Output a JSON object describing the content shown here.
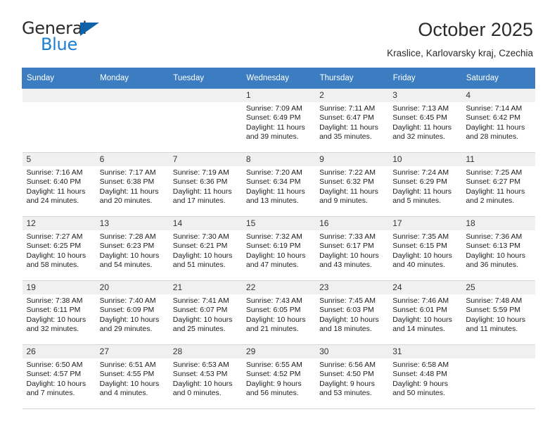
{
  "brand": {
    "name_primary": "General",
    "name_secondary": "Blue",
    "primary_color": "#2b2b2b",
    "secondary_color": "#1a7fd4",
    "triangle_color": "#0f62a8"
  },
  "header": {
    "month_title": "October 2025",
    "location": "Kraslice, Karlovarsky kraj, Czechia"
  },
  "calendar": {
    "header_bg": "#3b7dc0",
    "daynum_bg": "#f0f0f0",
    "weekday_headers": [
      "Sunday",
      "Monday",
      "Tuesday",
      "Wednesday",
      "Thursday",
      "Friday",
      "Saturday"
    ],
    "weeks": [
      [
        {
          "day": "",
          "sunrise": "",
          "sunset": "",
          "daylight": "",
          "daylight2": ""
        },
        {
          "day": "",
          "sunrise": "",
          "sunset": "",
          "daylight": "",
          "daylight2": ""
        },
        {
          "day": "",
          "sunrise": "",
          "sunset": "",
          "daylight": "",
          "daylight2": ""
        },
        {
          "day": "1",
          "sunrise": "Sunrise: 7:09 AM",
          "sunset": "Sunset: 6:49 PM",
          "daylight": "Daylight: 11 hours",
          "daylight2": "and 39 minutes."
        },
        {
          "day": "2",
          "sunrise": "Sunrise: 7:11 AM",
          "sunset": "Sunset: 6:47 PM",
          "daylight": "Daylight: 11 hours",
          "daylight2": "and 35 minutes."
        },
        {
          "day": "3",
          "sunrise": "Sunrise: 7:13 AM",
          "sunset": "Sunset: 6:45 PM",
          "daylight": "Daylight: 11 hours",
          "daylight2": "and 32 minutes."
        },
        {
          "day": "4",
          "sunrise": "Sunrise: 7:14 AM",
          "sunset": "Sunset: 6:42 PM",
          "daylight": "Daylight: 11 hours",
          "daylight2": "and 28 minutes."
        }
      ],
      [
        {
          "day": "5",
          "sunrise": "Sunrise: 7:16 AM",
          "sunset": "Sunset: 6:40 PM",
          "daylight": "Daylight: 11 hours",
          "daylight2": "and 24 minutes."
        },
        {
          "day": "6",
          "sunrise": "Sunrise: 7:17 AM",
          "sunset": "Sunset: 6:38 PM",
          "daylight": "Daylight: 11 hours",
          "daylight2": "and 20 minutes."
        },
        {
          "day": "7",
          "sunrise": "Sunrise: 7:19 AM",
          "sunset": "Sunset: 6:36 PM",
          "daylight": "Daylight: 11 hours",
          "daylight2": "and 17 minutes."
        },
        {
          "day": "8",
          "sunrise": "Sunrise: 7:20 AM",
          "sunset": "Sunset: 6:34 PM",
          "daylight": "Daylight: 11 hours",
          "daylight2": "and 13 minutes."
        },
        {
          "day": "9",
          "sunrise": "Sunrise: 7:22 AM",
          "sunset": "Sunset: 6:32 PM",
          "daylight": "Daylight: 11 hours",
          "daylight2": "and 9 minutes."
        },
        {
          "day": "10",
          "sunrise": "Sunrise: 7:24 AM",
          "sunset": "Sunset: 6:29 PM",
          "daylight": "Daylight: 11 hours",
          "daylight2": "and 5 minutes."
        },
        {
          "day": "11",
          "sunrise": "Sunrise: 7:25 AM",
          "sunset": "Sunset: 6:27 PM",
          "daylight": "Daylight: 11 hours",
          "daylight2": "and 2 minutes."
        }
      ],
      [
        {
          "day": "12",
          "sunrise": "Sunrise: 7:27 AM",
          "sunset": "Sunset: 6:25 PM",
          "daylight": "Daylight: 10 hours",
          "daylight2": "and 58 minutes."
        },
        {
          "day": "13",
          "sunrise": "Sunrise: 7:28 AM",
          "sunset": "Sunset: 6:23 PM",
          "daylight": "Daylight: 10 hours",
          "daylight2": "and 54 minutes."
        },
        {
          "day": "14",
          "sunrise": "Sunrise: 7:30 AM",
          "sunset": "Sunset: 6:21 PM",
          "daylight": "Daylight: 10 hours",
          "daylight2": "and 51 minutes."
        },
        {
          "day": "15",
          "sunrise": "Sunrise: 7:32 AM",
          "sunset": "Sunset: 6:19 PM",
          "daylight": "Daylight: 10 hours",
          "daylight2": "and 47 minutes."
        },
        {
          "day": "16",
          "sunrise": "Sunrise: 7:33 AM",
          "sunset": "Sunset: 6:17 PM",
          "daylight": "Daylight: 10 hours",
          "daylight2": "and 43 minutes."
        },
        {
          "day": "17",
          "sunrise": "Sunrise: 7:35 AM",
          "sunset": "Sunset: 6:15 PM",
          "daylight": "Daylight: 10 hours",
          "daylight2": "and 40 minutes."
        },
        {
          "day": "18",
          "sunrise": "Sunrise: 7:36 AM",
          "sunset": "Sunset: 6:13 PM",
          "daylight": "Daylight: 10 hours",
          "daylight2": "and 36 minutes."
        }
      ],
      [
        {
          "day": "19",
          "sunrise": "Sunrise: 7:38 AM",
          "sunset": "Sunset: 6:11 PM",
          "daylight": "Daylight: 10 hours",
          "daylight2": "and 32 minutes."
        },
        {
          "day": "20",
          "sunrise": "Sunrise: 7:40 AM",
          "sunset": "Sunset: 6:09 PM",
          "daylight": "Daylight: 10 hours",
          "daylight2": "and 29 minutes."
        },
        {
          "day": "21",
          "sunrise": "Sunrise: 7:41 AM",
          "sunset": "Sunset: 6:07 PM",
          "daylight": "Daylight: 10 hours",
          "daylight2": "and 25 minutes."
        },
        {
          "day": "22",
          "sunrise": "Sunrise: 7:43 AM",
          "sunset": "Sunset: 6:05 PM",
          "daylight": "Daylight: 10 hours",
          "daylight2": "and 21 minutes."
        },
        {
          "day": "23",
          "sunrise": "Sunrise: 7:45 AM",
          "sunset": "Sunset: 6:03 PM",
          "daylight": "Daylight: 10 hours",
          "daylight2": "and 18 minutes."
        },
        {
          "day": "24",
          "sunrise": "Sunrise: 7:46 AM",
          "sunset": "Sunset: 6:01 PM",
          "daylight": "Daylight: 10 hours",
          "daylight2": "and 14 minutes."
        },
        {
          "day": "25",
          "sunrise": "Sunrise: 7:48 AM",
          "sunset": "Sunset: 5:59 PM",
          "daylight": "Daylight: 10 hours",
          "daylight2": "and 11 minutes."
        }
      ],
      [
        {
          "day": "26",
          "sunrise": "Sunrise: 6:50 AM",
          "sunset": "Sunset: 4:57 PM",
          "daylight": "Daylight: 10 hours",
          "daylight2": "and 7 minutes."
        },
        {
          "day": "27",
          "sunrise": "Sunrise: 6:51 AM",
          "sunset": "Sunset: 4:55 PM",
          "daylight": "Daylight: 10 hours",
          "daylight2": "and 4 minutes."
        },
        {
          "day": "28",
          "sunrise": "Sunrise: 6:53 AM",
          "sunset": "Sunset: 4:53 PM",
          "daylight": "Daylight: 10 hours",
          "daylight2": "and 0 minutes."
        },
        {
          "day": "29",
          "sunrise": "Sunrise: 6:55 AM",
          "sunset": "Sunset: 4:52 PM",
          "daylight": "Daylight: 9 hours",
          "daylight2": "and 56 minutes."
        },
        {
          "day": "30",
          "sunrise": "Sunrise: 6:56 AM",
          "sunset": "Sunset: 4:50 PM",
          "daylight": "Daylight: 9 hours",
          "daylight2": "and 53 minutes."
        },
        {
          "day": "31",
          "sunrise": "Sunrise: 6:58 AM",
          "sunset": "Sunset: 4:48 PM",
          "daylight": "Daylight: 9 hours",
          "daylight2": "and 50 minutes."
        },
        {
          "day": "",
          "sunrise": "",
          "sunset": "",
          "daylight": "",
          "daylight2": ""
        }
      ]
    ]
  }
}
